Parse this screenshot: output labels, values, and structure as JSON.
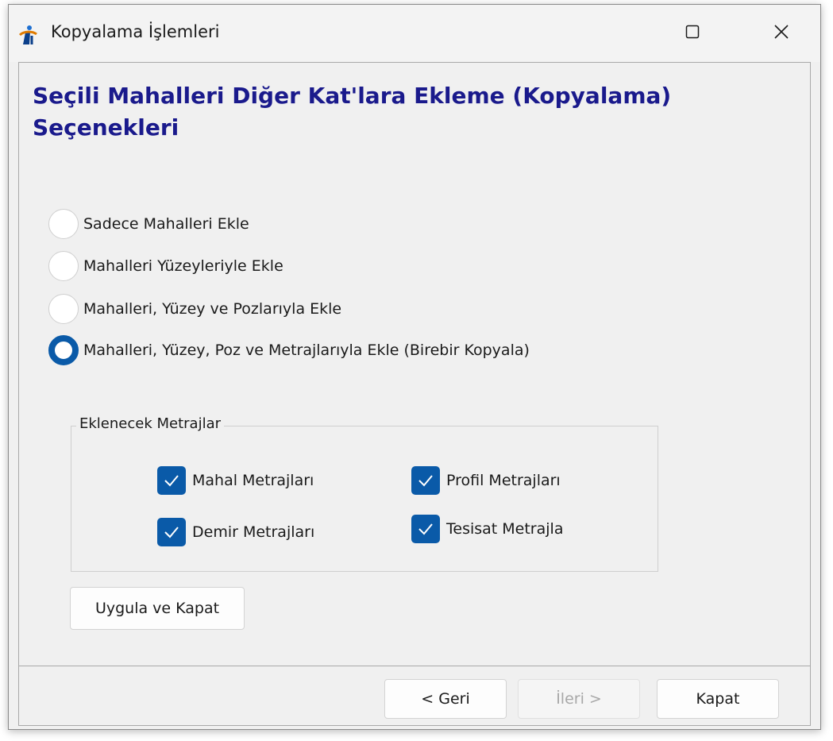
{
  "window": {
    "title": "Kopyalama İşlemleri",
    "app_icon": "app-logo-icon",
    "maximize_icon": "maximize-icon",
    "close_icon": "close-icon"
  },
  "heading": "Seçili Mahalleri Diğer Kat'lara Ekleme (Kopyalama) Seçenekleri",
  "options": [
    {
      "label": "Sadece Mahalleri Ekle",
      "selected": false
    },
    {
      "label": "Mahalleri Yüzeyleriyle Ekle",
      "selected": false
    },
    {
      "label": "Mahalleri, Yüzey ve Pozlarıyla Ekle",
      "selected": false
    },
    {
      "label": "Mahalleri, Yüzey, Poz ve Metrajlarıyla Ekle (Birebir Kopyala)",
      "selected": true
    }
  ],
  "group": {
    "title": "Eklenecek Metrajlar",
    "items": [
      {
        "label": "Mahal Metrajları",
        "checked": true
      },
      {
        "label": "Profil Metrajları",
        "checked": true
      },
      {
        "label": "Demir Metrajları",
        "checked": true
      },
      {
        "label": "Tesisat Metrajla",
        "checked": true
      }
    ]
  },
  "apply_button": "Uygula ve Kapat",
  "footer": {
    "back": "< Geri",
    "next": "İleri >",
    "close": "Kapat"
  },
  "colors": {
    "accent": "#0a5aa8",
    "heading": "#1a1a8c"
  }
}
